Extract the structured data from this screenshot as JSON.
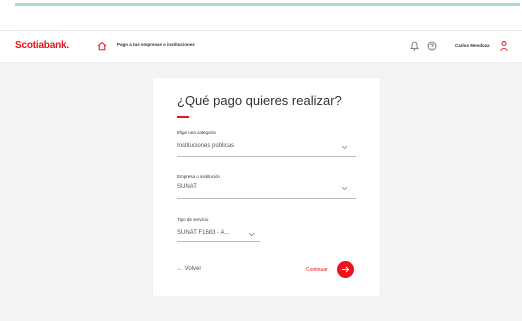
{
  "header": {
    "logo": "Scotiabank.",
    "breadcrumb": "Pago a tus empresas e instituciones",
    "user_name": "Carlos Mendoza"
  },
  "card": {
    "title": "¿Qué pago quieres realizar?",
    "category": {
      "label": "Elige una categoría",
      "value": "Instituciones públicas"
    },
    "company": {
      "label": "Empresa o institución",
      "value": "SUNAT"
    },
    "service": {
      "label": "Tipo de servicio",
      "value": "SUNAT F1683 - A..."
    },
    "back_label": "Volver",
    "continue_label": "Continuar"
  },
  "colors": {
    "brand": "#ec111a",
    "accent_strip": "#a8dccf"
  },
  "icons": [
    "home-icon",
    "bell-icon",
    "help-icon",
    "avatar-icon",
    "chevron-down-icon",
    "arrow-left-icon",
    "arrow-right-icon"
  ]
}
